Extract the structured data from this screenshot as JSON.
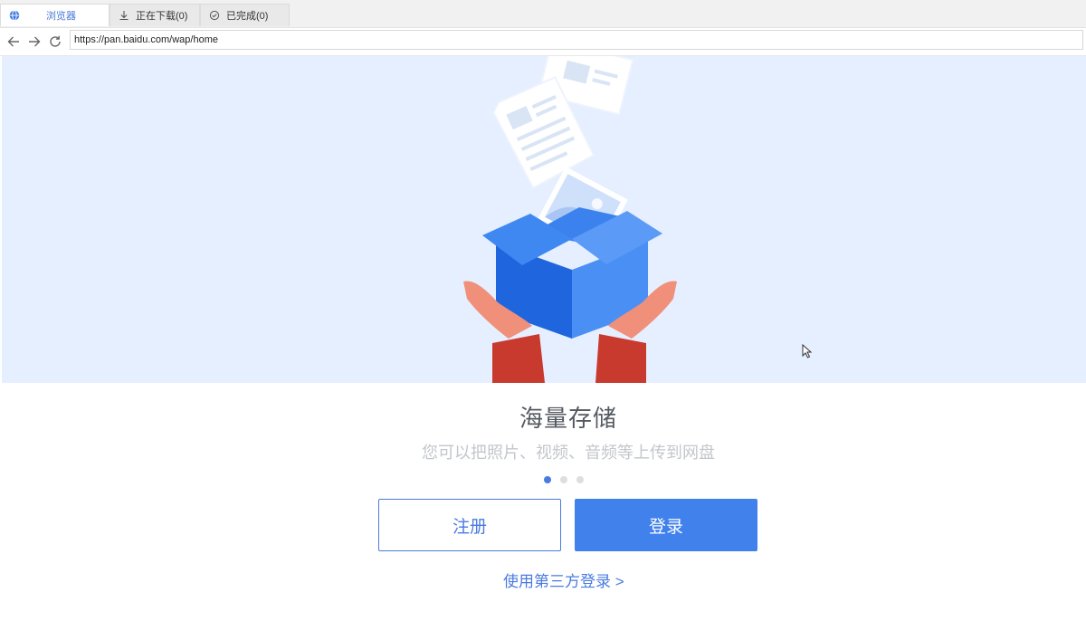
{
  "browser": {
    "tabs": [
      {
        "label": "浏览器",
        "icon": "globe-icon",
        "active": true
      },
      {
        "label": "正在下载(0)",
        "icon": "download-icon",
        "active": false
      },
      {
        "label": "已完成(0)",
        "icon": "check-circle-icon",
        "active": false
      }
    ],
    "url": "https://pan.baidu.com/wap/home"
  },
  "page": {
    "title": "海量存储",
    "subtitle": "您可以把照片、视频、音频等上传到网盘",
    "carousel": {
      "total": 3,
      "active_index": 0
    },
    "register_label": "注册",
    "login_label": "登录",
    "third_party_label": "使用第三方登录 >"
  },
  "colors": {
    "accent": "#4081ec",
    "hero_background": "#e5efff",
    "box_blue": "#2a6fe6",
    "sleeve_red": "#c93a2e"
  }
}
